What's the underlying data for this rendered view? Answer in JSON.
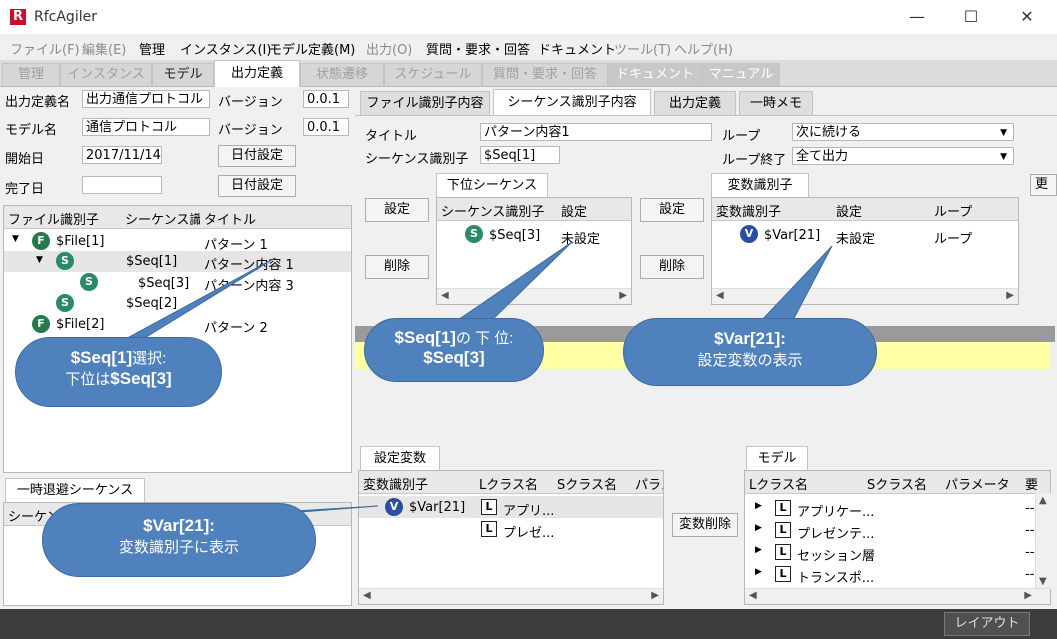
{
  "app": {
    "title": "RfcAgiler",
    "icon": "rfc-logo-icon"
  },
  "menu": [
    "ファイル(F)",
    "編集(E)",
    "管理",
    "インスタンス(I)",
    "モデル定義(M)",
    "出力(O)",
    "質問・要求・回答",
    "ドキュメント",
    "ツール(T)",
    "ヘルプ(H)"
  ],
  "tabs": [
    "管理",
    "インスタンス",
    "モデル",
    "出力定義",
    "状態遷移",
    "スケジュール",
    "質問・要求・回答",
    "ドキュメント",
    "マニュアル"
  ],
  "form": {
    "output_def_label": "出力定義名",
    "output_def_value": "出力通信プロトコル",
    "version_label": "バージョン",
    "version1": "0.0.1",
    "model_label": "モデル名",
    "model_value": "通信プロトコル",
    "version2": "0.0.1",
    "start_label": "開始日",
    "start_value": "2017/11/14",
    "date_button": "日付設定",
    "end_label": "完了日",
    "end_value": ""
  },
  "tree": {
    "headers": [
      "ファイル識別子",
      "シーケンス識別子",
      "タイトル"
    ],
    "rows": [
      {
        "file": "$File[1]",
        "seq": "",
        "title": "パターン 1"
      },
      {
        "file": "",
        "seq": "$Seq[1]",
        "title": "パターン内容 1"
      },
      {
        "file": "",
        "seq": "$Seq[3]",
        "title": "パターン内容 3"
      },
      {
        "file": "",
        "seq": "$Seq[2]",
        "title": ""
      },
      {
        "file": "$File[2]",
        "seq": "",
        "title": "パターン 2"
      }
    ]
  },
  "temp": {
    "tab": "一時退避シーケンス",
    "header": "シーケンス"
  },
  "subtabs": [
    "ファイル識別子内容",
    "シーケンス識別子内容",
    "出力定義",
    "一時メモ"
  ],
  "detail": {
    "title_label": "タイトル",
    "title_value": "パターン内容1",
    "seq_label": "シーケンス識別子",
    "seq_value": "$Seq[1]",
    "loop_label": "ループ",
    "loop_value": "次に続ける",
    "loop_end_label": "ループ終了",
    "loop_end_value": "全て出力",
    "set_button": "設定",
    "delete_button": "削除",
    "update_button": "更新"
  },
  "subseq": {
    "tab": "下位シーケンス",
    "headers": [
      "シーケンス識別子",
      "設定"
    ],
    "rows": [
      {
        "id": "$Seq[3]",
        "setting": "未設定"
      }
    ]
  },
  "vars": {
    "tab": "変数識別子",
    "headers": [
      "変数識別子",
      "設定",
      "ループ"
    ],
    "rows": [
      {
        "id": "$Var[21]",
        "setting": "未設定",
        "loop": "ループ"
      }
    ]
  },
  "setvars": {
    "tab": "設定変数",
    "headers": [
      "変数識別子",
      "Lクラス名",
      "Sクラス名",
      "パラメ"
    ],
    "var": "$Var[21]",
    "classes": [
      "アプリ...",
      "プレゼ..."
    ]
  },
  "var_delete_button": "変数削除",
  "model": {
    "tab": "モデル",
    "headers": [
      "Lクラス名",
      "Sクラス名",
      "パラメータ",
      "要"
    ],
    "rows": [
      "アプリケー...",
      "プレゼンテ...",
      "セッション層",
      "トランスポ..."
    ],
    "dash": "--"
  },
  "layout_button": "レイアウト",
  "callouts": {
    "c1_line1": "$Seq[1]",
    "c1_line1b": "選択:",
    "c1_line2a": "下位は",
    "c1_line2b": "$Seq[3]",
    "c2_line1": "$Seq[1]",
    "c2_line1b": "の 下 位:",
    "c2_line2": "$Seq[3]",
    "c3_line1": "$Var[21]:",
    "c3_line2": "設定変数の表示",
    "c4_line1": "$Var[21]:",
    "c4_line2": "変数識別子に表示"
  },
  "colors": {
    "callout": "#4f81bd",
    "highlight": "#ffffa6",
    "brand": "#c8102e"
  }
}
